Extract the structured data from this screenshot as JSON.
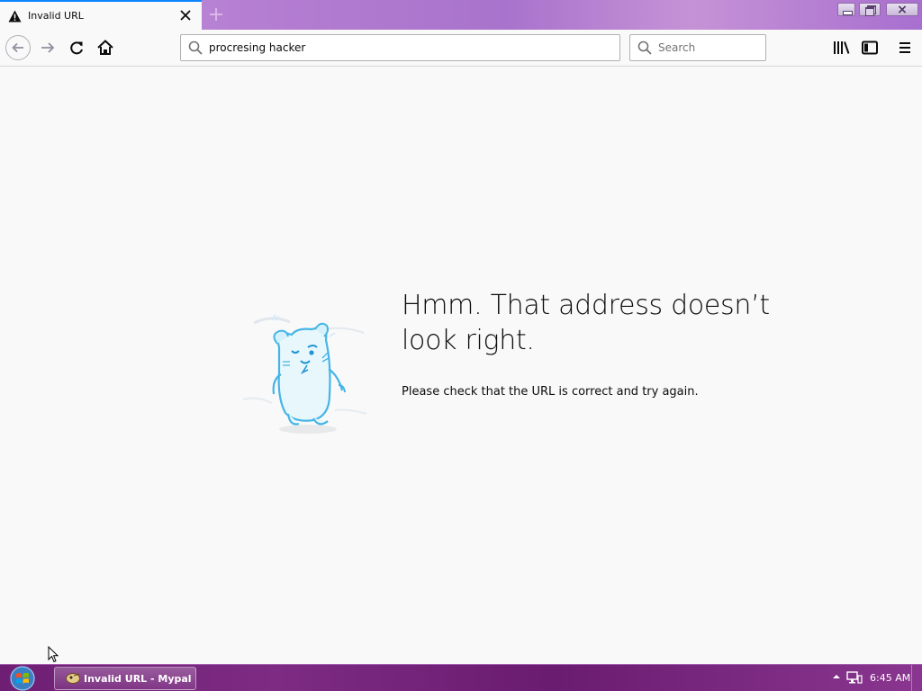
{
  "tab": {
    "title": "Invalid URL"
  },
  "navbar": {
    "url_value": "procresing hacker",
    "search_placeholder": "Search"
  },
  "error": {
    "title": "Hmm. That address doesn’t look right.",
    "description": "Please check that the URL is correct and try again."
  },
  "taskbar": {
    "task_label": "Invalid URL - Mypal",
    "clock": "6:45 AM"
  },
  "colors": {
    "accent": "#0a84ff",
    "titlebar_purple": "#a873cc",
    "taskbar_purple": "#6e1f74",
    "page_bg": "#f9f9fa"
  },
  "icons": [
    "warning-icon",
    "close-icon",
    "new-tab-icon",
    "back-arrow-icon",
    "forward-arrow-icon",
    "reload-icon",
    "home-icon",
    "search-icon",
    "library-icon",
    "sidebar-icon",
    "hamburger-menu-icon",
    "windows-start-icon",
    "tray-arrow-icon",
    "network-icon"
  ]
}
